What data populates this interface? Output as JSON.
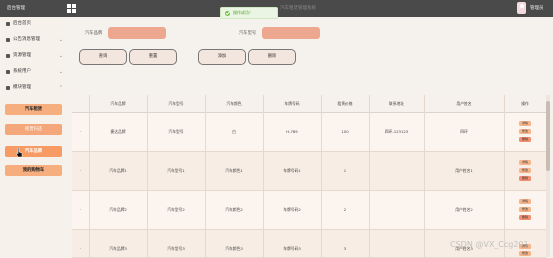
{
  "topbar": {
    "logo": "后台管理",
    "title": "汽车租赁管理系统",
    "user_name": "管理员"
  },
  "toast": {
    "message": "操作成功！"
  },
  "sidebar": {
    "menu": [
      {
        "label": "后台首页",
        "icon": "home-icon"
      },
      {
        "label": "公告消息管理",
        "icon": "message-icon"
      },
      {
        "label": "资源管理",
        "icon": "location-icon"
      },
      {
        "label": "系统用户",
        "icon": "user-icon"
      },
      {
        "label": "模块管理",
        "icon": "grid-icon"
      }
    ],
    "buttons": [
      {
        "label": "汽车租赁"
      },
      {
        "label": "租赁归还"
      },
      {
        "label": "汽车品牌"
      },
      {
        "label": "我的购物车"
      }
    ]
  },
  "search": {
    "brand_label": "汽车品牌",
    "model_label": "汽车型号",
    "query_label": "查询",
    "reset_label": "重置",
    "add_label": "添加",
    "delete_label": "删除"
  },
  "table": {
    "headers": [
      "汽车品牌",
      "汽车型号",
      "汽车颜色",
      "车牌号码",
      "租赁价格",
      "联系地址",
      "用户姓名",
      "操作"
    ],
    "rows": [
      {
        "cells": [
          "捷达品牌",
          "汽车型号",
          "白",
          "H-789",
          "100",
          "四环-123123",
          "四环",
          ""
        ]
      },
      {
        "cells": [
          "汽车品牌1",
          "汽车型号1",
          "汽车颜色1",
          "车牌号码1",
          "1",
          "",
          "用户姓名1",
          ""
        ]
      },
      {
        "cells": [
          "汽车品牌2",
          "汽车型号2",
          "汽车颜色2",
          "车牌号码2",
          "2",
          "",
          "用户姓名2",
          ""
        ]
      },
      {
        "cells": [
          "汽车品牌3",
          "汽车型号3",
          "汽车颜色3",
          "车牌号码3",
          "3",
          "",
          "用户姓名3",
          ""
        ]
      }
    ],
    "actions": {
      "edit": "详情",
      "modify": "修改",
      "delete": "删除"
    }
  },
  "watermark": "CSDN @VX_Ccg201",
  "colors": {
    "accent": "#f6ae7f",
    "input_fill": "#eea78f",
    "topbar": "#4a4a4a",
    "success": "#6cbf3d"
  }
}
